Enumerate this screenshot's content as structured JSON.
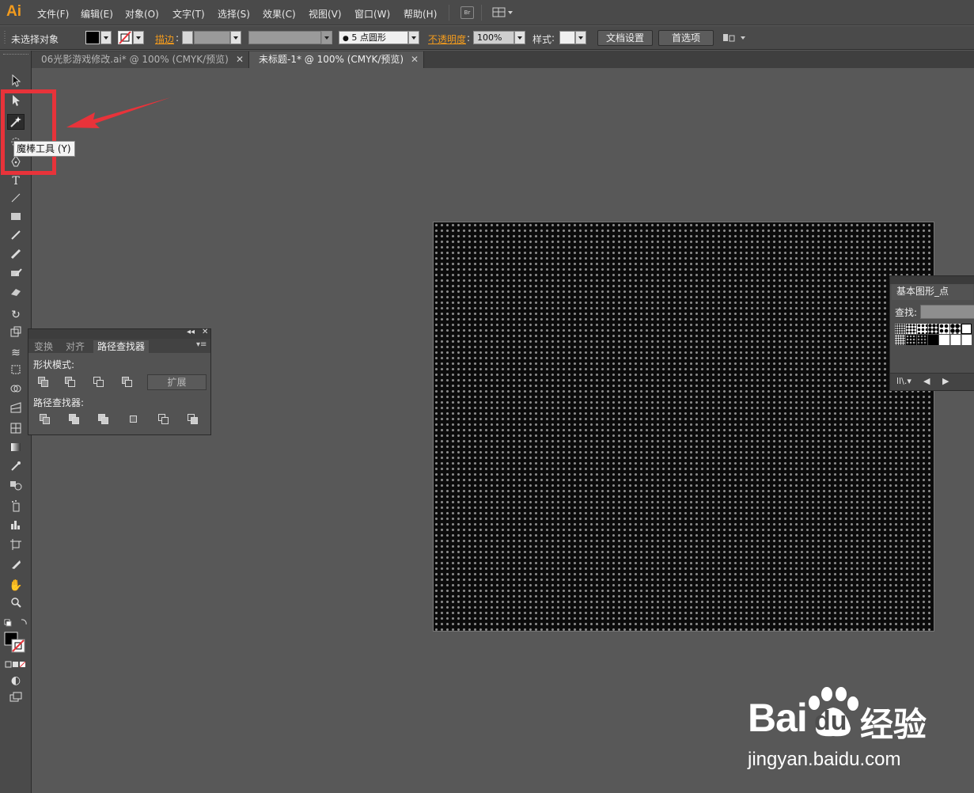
{
  "app": {
    "logo": "Ai"
  },
  "menubar": {
    "items": [
      "文件(F)",
      "编辑(E)",
      "对象(O)",
      "文字(T)",
      "选择(S)",
      "效果(C)",
      "视图(V)",
      "窗口(W)",
      "帮助(H)"
    ],
    "bridge_label": "Br"
  },
  "controlbar": {
    "selection_status": "未选择对象",
    "stroke_label": "描边",
    "brush_value": "5 点圆形",
    "opacity_label": "不透明度",
    "opacity_value": "100%",
    "style_label": "样式",
    "doc_setup_button": "文档设置",
    "prefs_button": "首选项"
  },
  "tabs": [
    {
      "label": "06光影游戏修改.ai* @ 100% (CMYK/预览)",
      "active": false
    },
    {
      "label": "未标题-1* @ 100% (CMYK/预览)",
      "active": true
    }
  ],
  "tooltip": "魔棒工具 (Y)",
  "pathfinder": {
    "tabs": [
      "变换",
      "对齐",
      "路径查找器"
    ],
    "active_tab": "路径查找器",
    "shape_modes_label": "形状模式:",
    "expand_button": "扩展",
    "pathfinders_label": "路径查找器:"
  },
  "symbols_panel": {
    "title": "基本图形_点",
    "search_label": "查找:"
  },
  "watermark": {
    "brand_left": "Bai",
    "brand_du": "du",
    "brand_cn": "经验",
    "url": "jingyan.baidu.com"
  },
  "colors": {
    "accent_orange": "#f29b1d",
    "highlight_red": "#e8333a",
    "canvas_bg": "#585858"
  },
  "icons": {
    "tools": [
      "selection-tool-icon",
      "direct-selection-tool-icon",
      "magic-wand-tool-icon",
      "lasso-tool-icon",
      "pen-tool-icon",
      "type-tool-icon",
      "line-tool-icon",
      "rectangle-tool-icon",
      "paintbrush-tool-icon",
      "pencil-tool-icon",
      "blob-brush-tool-icon",
      "eraser-tool-icon",
      "rotate-tool-icon",
      "scale-tool-icon",
      "warp-tool-icon",
      "free-transform-tool-icon",
      "shape-builder-tool-icon",
      "perspective-grid-tool-icon",
      "mesh-tool-icon",
      "gradient-tool-icon",
      "eyedropper-tool-icon",
      "blend-tool-icon",
      "symbol-sprayer-tool-icon",
      "column-graph-tool-icon",
      "artboard-tool-icon",
      "slice-tool-icon",
      "hand-tool-icon",
      "zoom-tool-icon"
    ]
  }
}
